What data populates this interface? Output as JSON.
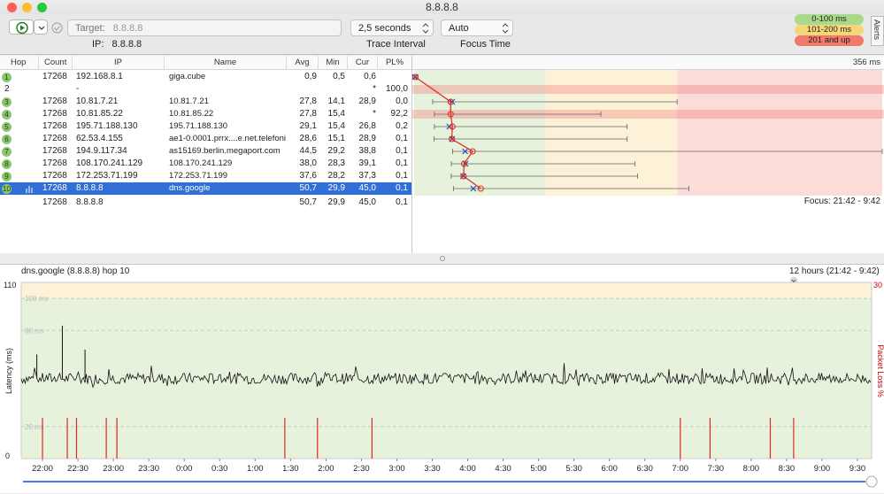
{
  "window": {
    "title": "8.8.8.8"
  },
  "toolbar": {
    "target_label": "Target:",
    "target_value": "8.8.8.8",
    "ip_label": "IP:",
    "ip_value": "8.8.8.8",
    "interval_value": "2,5 seconds",
    "interval_caption": "Trace Interval",
    "focus_value": "Auto",
    "focus_caption": "Focus Time",
    "legend": [
      {
        "label": "0-100 ms",
        "color": "#a9d98a"
      },
      {
        "label": "101-200 ms",
        "color": "#f5d77a"
      },
      {
        "label": "201 and up",
        "color": "#ef7a6a"
      }
    ],
    "alerts_label": "Alerts"
  },
  "table": {
    "headers": [
      "Hop",
      "Count",
      "IP",
      "Name",
      "Avg",
      "Min",
      "Cur",
      "PL%"
    ],
    "graph_max_label": "356 ms",
    "rows": [
      {
        "hop": "1",
        "count": "17268",
        "ip": "192.168.8.1",
        "name": "giga.cube",
        "avg": "0,9",
        "min": "0,5",
        "cur": "0,6",
        "pl": "",
        "min_ms": 0.5,
        "avg_ms": 0.9,
        "max_ms": 3,
        "cur_ms": 0.6
      },
      {
        "hop": "2",
        "count": "",
        "ip": "-",
        "name": "",
        "avg": "",
        "min": "",
        "cur": "*",
        "pl": "100,0",
        "min_ms": null,
        "avg_ms": null,
        "max_ms": null,
        "cur_ms": null
      },
      {
        "hop": "3",
        "count": "17268",
        "ip": "10.81.7.21",
        "name": "10.81.7.21",
        "avg": "27,8",
        "min": "14,1",
        "cur": "28,9",
        "pl": "0,0",
        "min_ms": 14.1,
        "avg_ms": 27.8,
        "max_ms": 200,
        "cur_ms": 28.9
      },
      {
        "hop": "4",
        "count": "17268",
        "ip": "10.81.85.22",
        "name": "10.81.85.22",
        "avg": "27,8",
        "min": "15,4",
        "cur": "*",
        "pl": "92,2",
        "min_ms": 15.4,
        "avg_ms": 27.8,
        "max_ms": 142,
        "cur_ms": null
      },
      {
        "hop": "5",
        "count": "17268",
        "ip": "195.71.188.130",
        "name": "195.71.188.130",
        "avg": "29,1",
        "min": "15,4",
        "cur": "26,8",
        "pl": "0,2",
        "min_ms": 15.4,
        "avg_ms": 29.1,
        "max_ms": 162,
        "cur_ms": 26.8
      },
      {
        "hop": "6",
        "count": "17268",
        "ip": "62.53.4.155",
        "name": "ae1-0.0001.prrx....e.net.telefonica.de",
        "avg": "28,6",
        "min": "15,1",
        "cur": "28,9",
        "pl": "0,1",
        "min_ms": 15.1,
        "avg_ms": 28.6,
        "max_ms": 162,
        "cur_ms": 28.9
      },
      {
        "hop": "7",
        "count": "17268",
        "ip": "194.9.117.34",
        "name": "as15169.berlin.megaport.com",
        "avg": "44,5",
        "min": "29,2",
        "cur": "38,8",
        "pl": "0,1",
        "min_ms": 29.2,
        "avg_ms": 44.5,
        "max_ms": 356,
        "cur_ms": 38.8
      },
      {
        "hop": "8",
        "count": "17268",
        "ip": "108.170.241.129",
        "name": "108.170.241.129",
        "avg": "38,0",
        "min": "28,3",
        "cur": "39,1",
        "pl": "0,1",
        "min_ms": 28.3,
        "avg_ms": 38.0,
        "max_ms": 168,
        "cur_ms": 39.1
      },
      {
        "hop": "9",
        "count": "17268",
        "ip": "172.253.71.199",
        "name": "172.253.71.199",
        "avg": "37,6",
        "min": "28,2",
        "cur": "37,3",
        "pl": "0,1",
        "min_ms": 28.2,
        "avg_ms": 37.6,
        "max_ms": 170,
        "cur_ms": 37.3
      },
      {
        "hop": "10",
        "count": "17268",
        "ip": "8.8.8.8",
        "name": "dns.google",
        "avg": "50,7",
        "min": "29,9",
        "cur": "45,0",
        "pl": "0,1",
        "min_ms": 29.9,
        "avg_ms": 50.7,
        "max_ms": 209,
        "cur_ms": 45.0,
        "selected": true
      }
    ],
    "summary": {
      "count": "17268",
      "ip": "8.8.8.8",
      "avg": "50,7",
      "min": "29,9",
      "cur": "45,0",
      "pl": "0,1"
    },
    "focus_label": "Focus: 21:42 - 9:42"
  },
  "history": {
    "title": "dns.google (8.8.8.8) hop 10",
    "range_label": "12 hours (21:42 - 9:42)",
    "y_left_label": "Latency (ms)",
    "y_right_label": "Packet Loss %",
    "y_left_max": "110",
    "y_left_min": "0",
    "y_right_max": "30",
    "gridlines": [
      "100 ms",
      "80 ms",
      "20 ms"
    ],
    "x_ticks": [
      "22:00",
      "22:30",
      "23:00",
      "23:30",
      "0:00",
      "0:30",
      "1:00",
      "1:30",
      "2:00",
      "2:30",
      "3:00",
      "3:30",
      "4:00",
      "4:30",
      "5:00",
      "5:30",
      "6:00",
      "6:30",
      "7:00",
      "7:30",
      "8:00",
      "8:30",
      "9:00",
      "9:30"
    ],
    "loss_spikes_hours": [
      22.0,
      22.35,
      22.48,
      22.9,
      23.05,
      1.42,
      1.88,
      2.65,
      7.0,
      7.42,
      8.27,
      8.6
    ],
    "latency_spikes": [
      {
        "hour": 22.28,
        "ms": 83
      },
      {
        "hour": 21.92,
        "ms": 65
      },
      {
        "hour": 22.6,
        "ms": 68
      }
    ],
    "baseline_ms": 50
  },
  "colors": {
    "green": "#e6f2dc",
    "yellow": "#fdf1d8",
    "red": "#fbdcd9",
    "selection": "#2f6fd6",
    "loss": "#e0281b"
  }
}
